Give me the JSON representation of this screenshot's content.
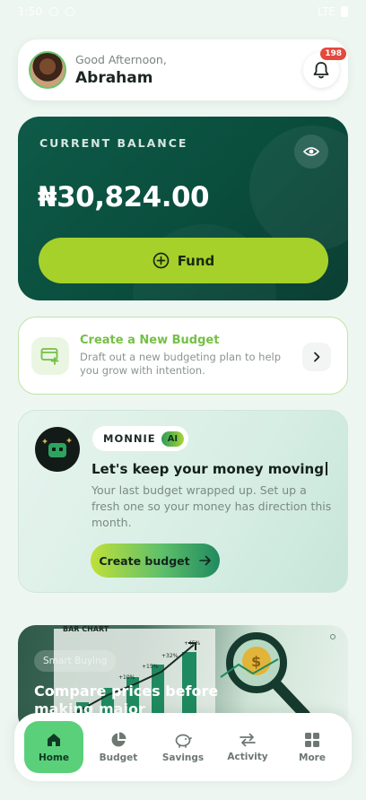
{
  "status_bar": {
    "time": "1:50",
    "network": "LTE"
  },
  "header": {
    "greeting": "Good Afternoon,",
    "user_name": "Abraham",
    "notification_count": "198"
  },
  "balance": {
    "label": "CURRENT BALANCE",
    "amount": "₦30,824.00",
    "fund_label": "Fund"
  },
  "budget_prompt": {
    "title": "Create a New Budget",
    "description": "Draft out a new budgeting plan to help you grow with intention."
  },
  "monnie": {
    "name": "MONNIE",
    "ai_badge": "AI",
    "headline": "Let's keep your money moving",
    "body": "Your last budget wrapped up. Set up a fresh one so your money has direction this month.",
    "cta": "Create budget"
  },
  "promo": {
    "chart_label": "BAR CHART",
    "tag": "Smart Buying",
    "title": "Compare prices before making major purchases",
    "bar_labels": [
      "+10%",
      "+15%",
      "+32%",
      "+45%"
    ]
  },
  "nav": {
    "items": [
      {
        "label": "Home",
        "icon": "home-icon"
      },
      {
        "label": "Budget",
        "icon": "pie-chart-icon"
      },
      {
        "label": "Savings",
        "icon": "piggy-bank-icon"
      },
      {
        "label": "Activity",
        "icon": "transfer-arrows-icon"
      },
      {
        "label": "More",
        "icon": "grid-icon"
      }
    ],
    "active": "Home"
  },
  "colors": {
    "brand_dark": "#0b4d3d",
    "accent_lime": "#a6d12b",
    "budget_green": "#74c045",
    "badge_red": "#e5483d",
    "nav_active": "#5bd07a"
  }
}
